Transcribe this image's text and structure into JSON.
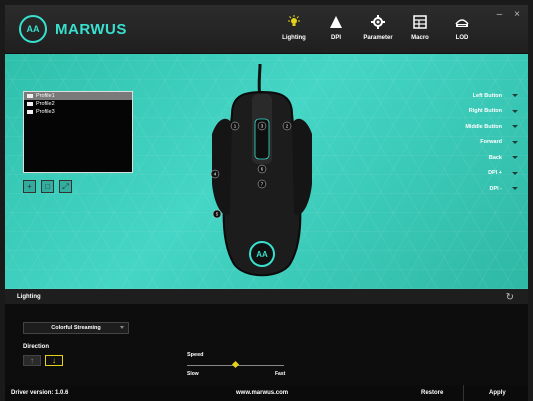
{
  "app": {
    "name": "MARWUS",
    "badge": "AA"
  },
  "nav": [
    {
      "label": "Lighting",
      "icon": "lightbulb-icon",
      "active": true
    },
    {
      "label": "DPI",
      "icon": "triangle-icon"
    },
    {
      "label": "Parameter",
      "icon": "gear-icon"
    },
    {
      "label": "Macro",
      "icon": "macro-icon"
    },
    {
      "label": "LOD",
      "icon": "lod-icon"
    }
  ],
  "window": {
    "minimize": "–",
    "close": "×"
  },
  "profiles": [
    "Profile1",
    "Profile2",
    "Profile3"
  ],
  "profile_actions": [
    "+",
    "□",
    "⤢"
  ],
  "mouse": {
    "buttons": [
      "1",
      "2",
      "3",
      "4",
      "5",
      "6",
      "7"
    ],
    "logo": "AA"
  },
  "assignments": [
    "Left Button",
    "Right Button",
    "Middle Button",
    "Forward",
    "Back",
    "DPI +",
    "DPI -"
  ],
  "lighting": {
    "title": "Lighting",
    "mode": "Colorful Streaming",
    "direction_label": "Direction",
    "speed_label": "Speed",
    "speed_min": "Slow",
    "speed_max": "Fast",
    "speed_value": 0.5
  },
  "footer": {
    "driver": "Driver version: 1.0.6",
    "site": "www.marwus.com",
    "restore": "Restore",
    "apply": "Apply"
  },
  "colors": {
    "accent": "#37e0cf",
    "highlight": "#e3d21a"
  }
}
